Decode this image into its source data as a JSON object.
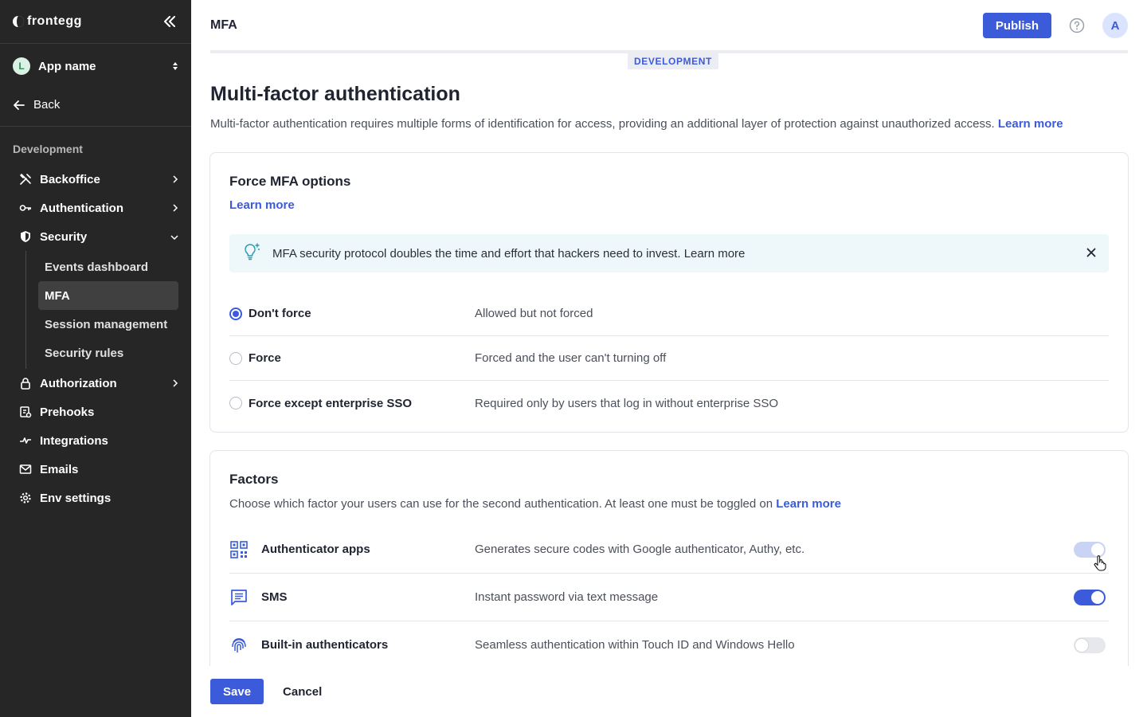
{
  "brand": {
    "name": "frontegg"
  },
  "app": {
    "avatar_letter": "L",
    "name": "App name"
  },
  "sidebar": {
    "back_label": "Back",
    "section_label": "Development",
    "items": [
      {
        "label": "Backoffice",
        "icon": "tools-icon"
      },
      {
        "label": "Authentication",
        "icon": "key-icon"
      },
      {
        "label": "Security",
        "icon": "shield-icon"
      },
      {
        "label": "Authorization",
        "icon": "lock-icon"
      },
      {
        "label": "Prehooks",
        "icon": "prehooks-icon"
      },
      {
        "label": "Integrations",
        "icon": "integrations-icon"
      },
      {
        "label": "Emails",
        "icon": "mail-icon"
      },
      {
        "label": "Env settings",
        "icon": "gear-icon"
      }
    ],
    "security_sub": [
      "Events dashboard",
      "MFA",
      "Session management",
      "Security rules"
    ],
    "active_sub": "MFA"
  },
  "header": {
    "breadcrumb": "MFA",
    "publish_label": "Publish",
    "user_initial": "A"
  },
  "env_badge": "DEVELOPMENT",
  "page": {
    "title": "Multi-factor authentication",
    "description": "Multi-factor authentication requires multiple forms of identification for access, providing an additional layer of protection against unauthorized access.",
    "learn_more": "Learn more"
  },
  "force_mfa": {
    "title": "Force MFA options",
    "learn_more": "Learn more",
    "banner_text": "MFA security protocol doubles the time and effort that hackers need to invest.",
    "banner_link": "Learn more",
    "selected": "Don't force",
    "options": [
      {
        "label": "Don't force",
        "description": "Allowed but not forced",
        "checked": true
      },
      {
        "label": "Force",
        "description": "Forced and the user can't turning off",
        "checked": false
      },
      {
        "label": "Force except enterprise SSO",
        "description": "Required only by users that log in without enterprise SSO",
        "checked": false
      }
    ]
  },
  "factors": {
    "title": "Factors",
    "description": "Choose which factor your users can use for the second authentication. At least one must be toggled on",
    "learn_more": "Learn more",
    "items": [
      {
        "name": "Authenticator apps",
        "description": "Generates secure codes with Google authenticator, Authy, etc.",
        "enabled": true,
        "icon": "qr-code-icon"
      },
      {
        "name": "SMS",
        "description": "Instant password via text message",
        "enabled": true,
        "icon": "message-icon"
      },
      {
        "name": "Built-in authenticators",
        "description": "Seamless authentication within Touch ID and Windows Hello",
        "enabled": false,
        "icon": "fingerprint-icon"
      }
    ]
  },
  "actions": {
    "save_label": "Save",
    "cancel_label": "Cancel"
  },
  "colors": {
    "accent": "#3b5bdb",
    "sidebar_bg": "#262626",
    "banner_bg": "#eef8fb"
  }
}
